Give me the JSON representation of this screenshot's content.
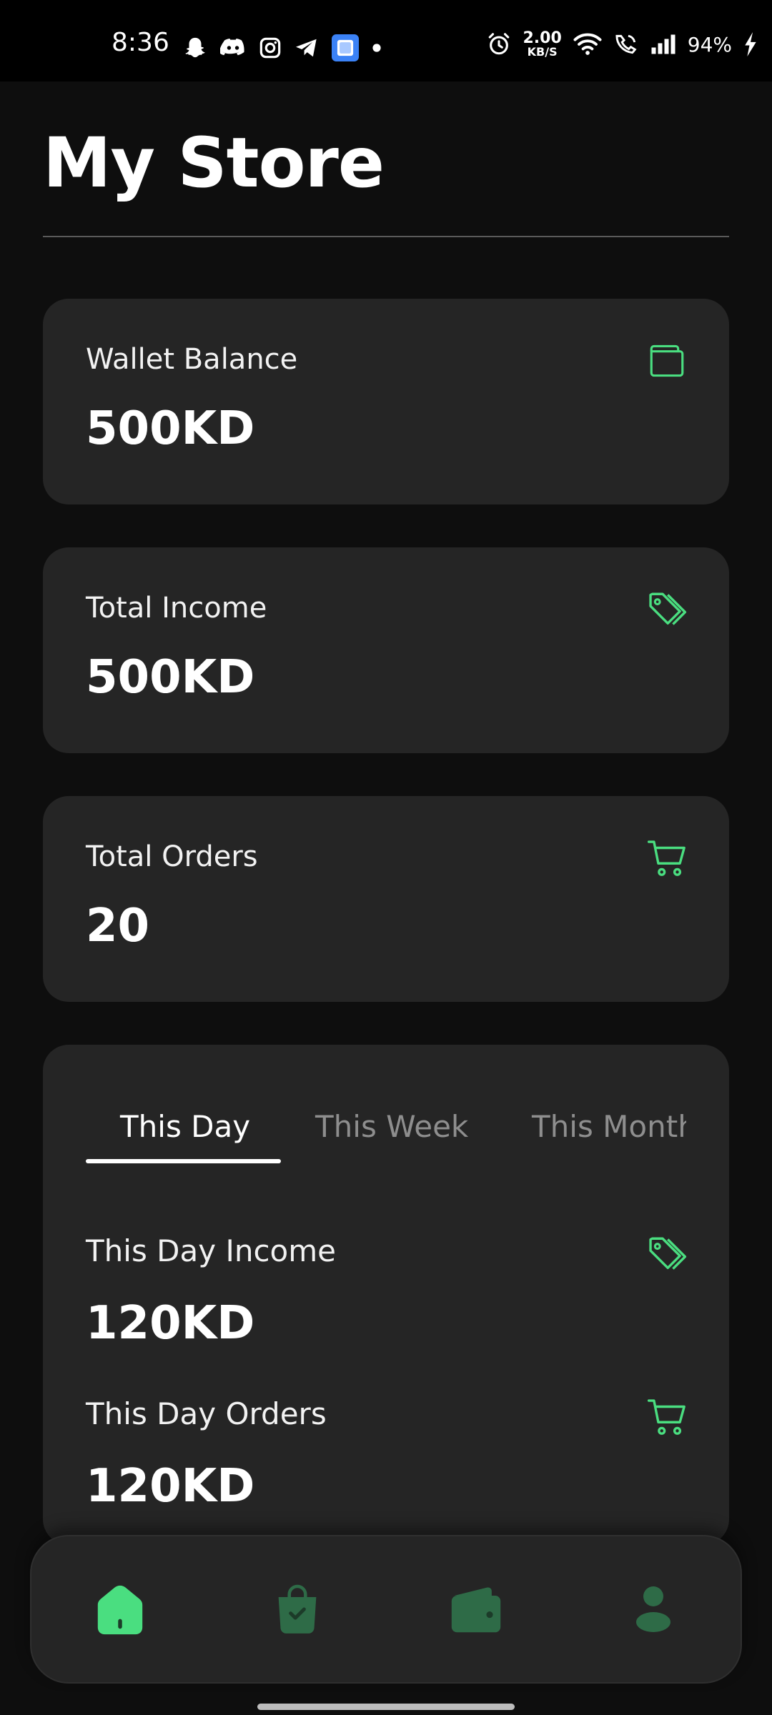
{
  "status_bar": {
    "time": "8:36",
    "net_speed": "2.00",
    "net_unit": "KB/S",
    "battery": "94%",
    "icons_left": [
      "snapchat-icon",
      "discord-icon",
      "instagram-icon",
      "telegram-icon",
      "app-icon",
      "dot-icon"
    ],
    "icons_right": [
      "alarm-icon",
      "wifi-icon",
      "wifi-call-icon",
      "signal-icon",
      "charging-icon"
    ]
  },
  "header": {
    "title": "My Store"
  },
  "cards": {
    "wallet": {
      "label": "Wallet Balance",
      "value": "500KD",
      "icon": "wallet-icon"
    },
    "income": {
      "label": "Total Income",
      "value": "500KD",
      "icon": "tag-icon"
    },
    "orders": {
      "label": "Total Orders",
      "value": "20",
      "icon": "cart-icon"
    }
  },
  "stats_panel": {
    "tabs": [
      "This Day",
      "This Week",
      "This Month"
    ],
    "active_tab": "This Day",
    "rows": [
      {
        "label": "This Day Income",
        "value": "120KD",
        "icon": "tag-icon"
      },
      {
        "label": "This Day Orders",
        "value": "120KD",
        "icon": "cart-icon"
      }
    ]
  },
  "bottom_nav": {
    "items": [
      "home-icon",
      "shopping-bag-icon",
      "wallet-icon",
      "profile-icon"
    ],
    "active": "home-icon"
  },
  "colors": {
    "background": "#0e0e0e",
    "card": "#252525",
    "accent": "#4ade80",
    "accent_dim": "#2e6b47",
    "text": "#ffffff",
    "muted_tab": "#8e8e8e"
  }
}
